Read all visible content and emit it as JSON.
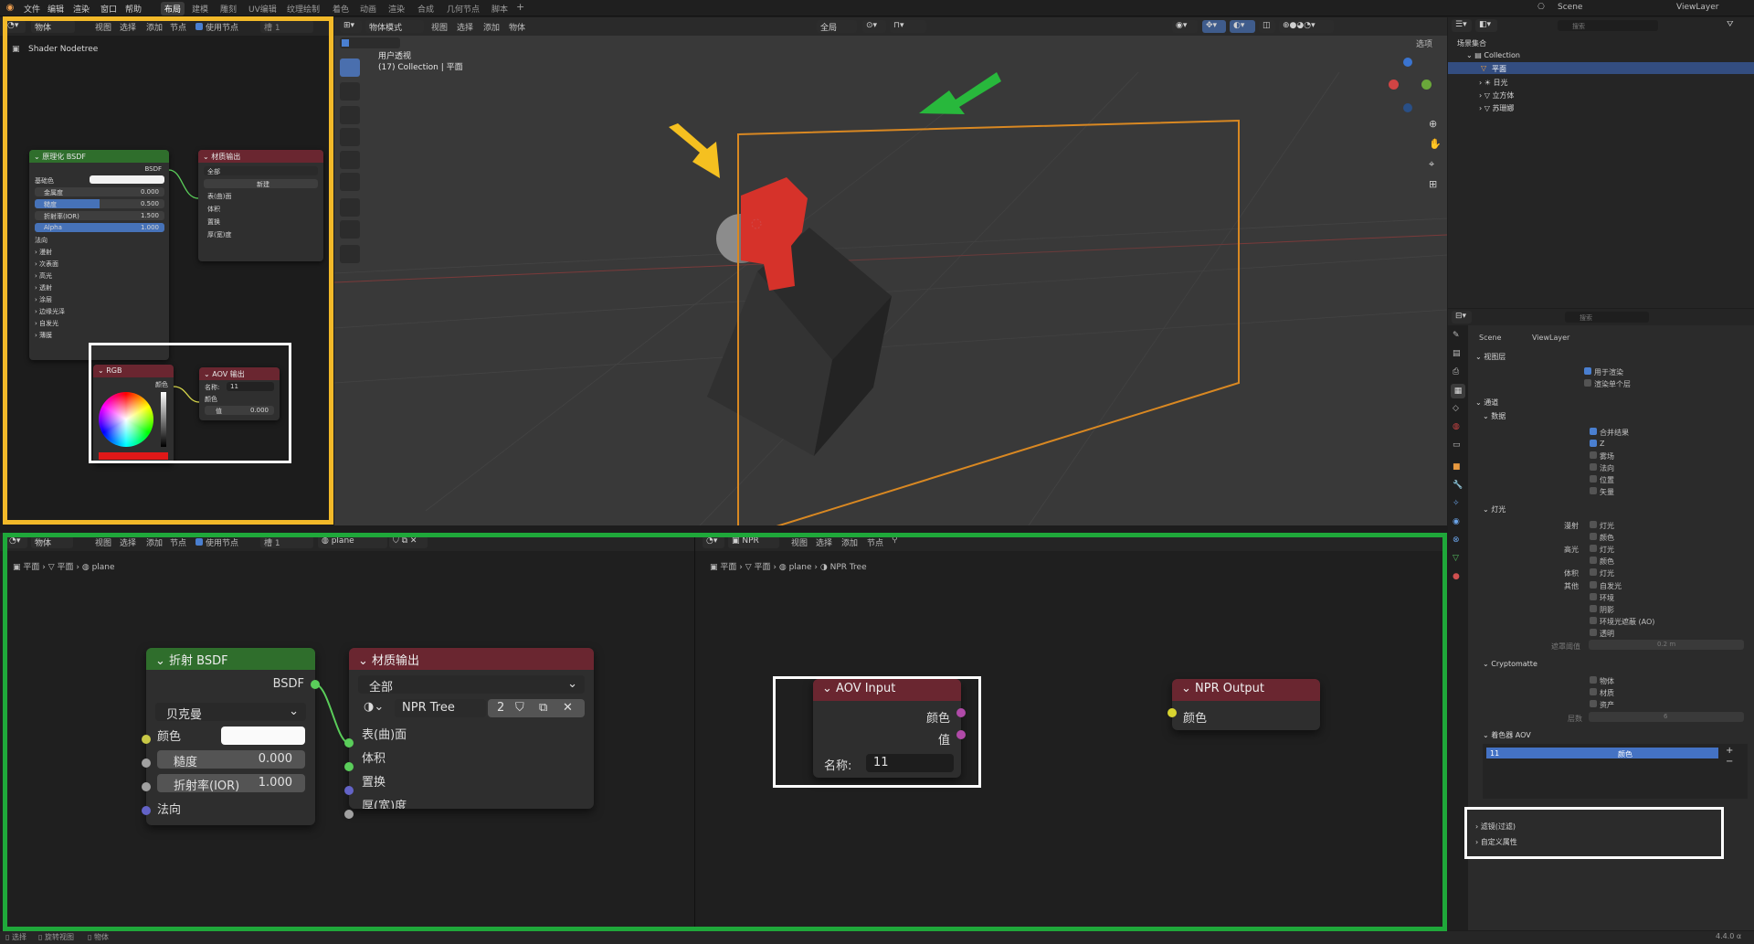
{
  "menubar": {
    "items": [
      "文件",
      "编辑",
      "渲染",
      "窗口",
      "帮助"
    ],
    "workspaces": [
      "布局",
      "建模",
      "雕刻",
      "UV编辑",
      "纹理绘制",
      "着色",
      "动画",
      "渲染",
      "合成",
      "几何节点",
      "脚本"
    ],
    "active_workspace": "布局",
    "scene": "Scene",
    "view_layer": "ViewLayer"
  },
  "top_node_editor": {
    "mode": "物体",
    "menus": [
      "视图",
      "选择",
      "添加",
      "节点"
    ],
    "use_nodes_label": "使用节点",
    "slot": "槽 1",
    "tree_label": "Shader Nodetree",
    "bsdf_node": {
      "title": "原理化 BSDF",
      "output": "BSDF",
      "rows": [
        {
          "label": "基础色"
        },
        {
          "label": "金属度",
          "value": "0.000"
        },
        {
          "label": "糙度",
          "value": "0.500"
        },
        {
          "label": "折射率(IOR)",
          "value": "1.500"
        },
        {
          "label": "Alpha",
          "value": "1.000"
        }
      ],
      "normal": "法向",
      "panels": [
        "漫射",
        "次表面",
        "高光",
        "透射",
        "涂层",
        "边缘光泽",
        "自发光",
        "薄膜"
      ]
    },
    "output_node": {
      "title": "材质输出",
      "target": "全部",
      "new_label": "新建",
      "inputs": [
        "表(曲)面",
        "体积",
        "置换",
        "厚(宽)度"
      ]
    },
    "rgb_node": {
      "title": "RGB",
      "output": "颜色"
    },
    "aov_node": {
      "title": "AOV 输出",
      "name_label": "名称:",
      "name_value": "11",
      "inputs": [
        "颜色",
        "值"
      ],
      "value": "0.000"
    }
  },
  "viewport": {
    "mode": "物体模式",
    "menus": [
      "视图",
      "选择",
      "添加",
      "物体"
    ],
    "transform": "全局",
    "view_name": "用户透视",
    "collection_info": "(17) Collection | 平面",
    "options": "选项"
  },
  "outliner": {
    "search_placeholder": "搜索",
    "root": "场景集合",
    "collection": "Collection",
    "items": [
      "平面",
      "日光",
      "立方体",
      "苏珊娜"
    ]
  },
  "properties": {
    "search_placeholder": "搜索",
    "breadcrumb": [
      "Scene",
      "ViewLayer"
    ],
    "view_layer_section": "视图层",
    "use_for_render": "用于渲染",
    "render_single_layer": "渲染单个层",
    "passes_section": "通道",
    "data_section": "数据",
    "data_items": [
      "合并结果",
      "Z",
      "雾场",
      "法向",
      "位置",
      "矢量"
    ],
    "light_section": "灯光",
    "light_groups": [
      {
        "label": "漫射",
        "items": [
          "灯光",
          "颜色"
        ]
      },
      {
        "label": "高光",
        "items": [
          "灯光",
          "颜色"
        ]
      },
      {
        "label": "体积",
        "items": [
          "灯光"
        ]
      },
      {
        "label": "其他",
        "items": [
          "自发光",
          "环境",
          "阴影",
          "环境光遮蔽 (AO)",
          "透明"
        ]
      }
    ],
    "alpha_threshold_label": "遮罩阈值",
    "alpha_threshold_value": "0.2 m",
    "cryptomatte_section": "Cryptomatte",
    "crypto_items": [
      "物体",
      "材质",
      "资产"
    ],
    "levels_label": "层数",
    "levels_value": "6",
    "shader_aov_section": "着色器 AOV",
    "aov_name": "11",
    "aov_type": "颜色",
    "filter_section": "滤镜(过滤)",
    "custom_props": "自定义属性"
  },
  "bottom_left_editor": {
    "mode": "物体",
    "menus": [
      "视图",
      "选择",
      "添加",
      "节点"
    ],
    "use_nodes_label": "使用节点",
    "slot": "槽 1",
    "material": "plane",
    "breadcrumb": [
      "平面",
      "平面",
      "plane"
    ],
    "bsdf_node": {
      "title": "折射 BSDF",
      "output": "BSDF",
      "distribution": "贝克曼",
      "color_label": "颜色",
      "roughness_label": "糙度",
      "roughness_value": "0.000",
      "ior_label": "折射率(IOR)",
      "ior_value": "1.000",
      "normal": "法向"
    },
    "output_node": {
      "title": "材质输出",
      "target": "全部",
      "tree_name": "NPR Tree",
      "users": "2",
      "inputs": [
        "表(曲)面",
        "体积",
        "置换",
        "厚(宽)度"
      ]
    }
  },
  "bottom_right_editor": {
    "tree_type": "NPR",
    "menus": [
      "视图",
      "选择",
      "添加",
      "节点"
    ],
    "breadcrumb": [
      "平面",
      "平面",
      "plane",
      "NPR Tree"
    ],
    "aov_input_node": {
      "title": "AOV Input",
      "outputs": [
        "颜色",
        "值"
      ],
      "name_label": "名称:",
      "name_value": "11"
    },
    "npr_output_node": {
      "title": "NPR Output",
      "input": "颜色"
    }
  },
  "statusbar": {
    "items": [
      "选择",
      "旋转视图",
      "物体"
    ],
    "version": "4.4.0 α"
  },
  "colors": {
    "yellow_highlight": "#f2b929",
    "green_highlight": "#1fa83a",
    "white_highlight": "#ffffff",
    "shader_green": "#2f6e2c",
    "output_red": "#6a2630",
    "arrow_yellow": "#f5c020",
    "arrow_green": "#28b83c",
    "red_object": "#d6322a",
    "plane_orange": "#d98822"
  }
}
